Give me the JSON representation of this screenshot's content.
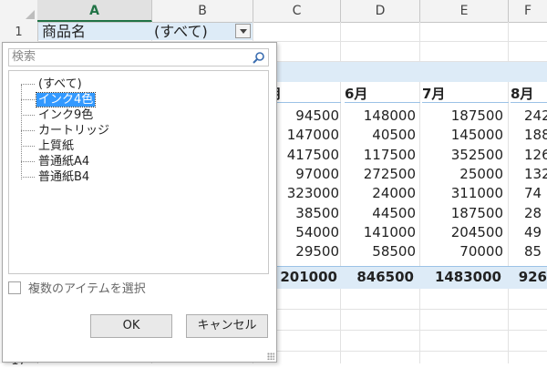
{
  "sheet": {
    "columns": [
      "A",
      "B",
      "C",
      "D",
      "E",
      "F"
    ],
    "active_column": "A",
    "rows": [
      "1",
      "17"
    ],
    "a1": "商品名",
    "b1": "(すべて)",
    "months": [
      "月",
      "6月",
      "7月",
      "8月"
    ],
    "data_rows": [
      [
        "94500",
        "148000",
        "187500",
        "242"
      ],
      [
        "147000",
        "40500",
        "145000",
        "188"
      ],
      [
        "417500",
        "117500",
        "352500",
        "126"
      ],
      [
        "97000",
        "272500",
        "25000",
        "132"
      ],
      [
        "323000",
        "24000",
        "311000",
        "74"
      ],
      [
        "38500",
        "44500",
        "187500",
        "28"
      ],
      [
        "54000",
        "141000",
        "204500",
        "49"
      ],
      [
        "29500",
        "58500",
        "70000",
        "85"
      ]
    ],
    "totals": [
      "201000",
      "846500",
      "1483000",
      "926"
    ]
  },
  "filter_panel": {
    "search_placeholder": "検索",
    "items": [
      "(すべて)",
      "インク4色",
      "インク9色",
      "カートリッジ",
      "上質紙",
      "普通紙A4",
      "普通紙B4"
    ],
    "selected_item": "インク4色",
    "multi_select_label": "複数のアイテムを選択",
    "ok_label": "OK",
    "cancel_label": "キャンセル"
  },
  "colors": {
    "accent": "#217346",
    "band": "#ddebf7",
    "selection": "#3399ff"
  }
}
